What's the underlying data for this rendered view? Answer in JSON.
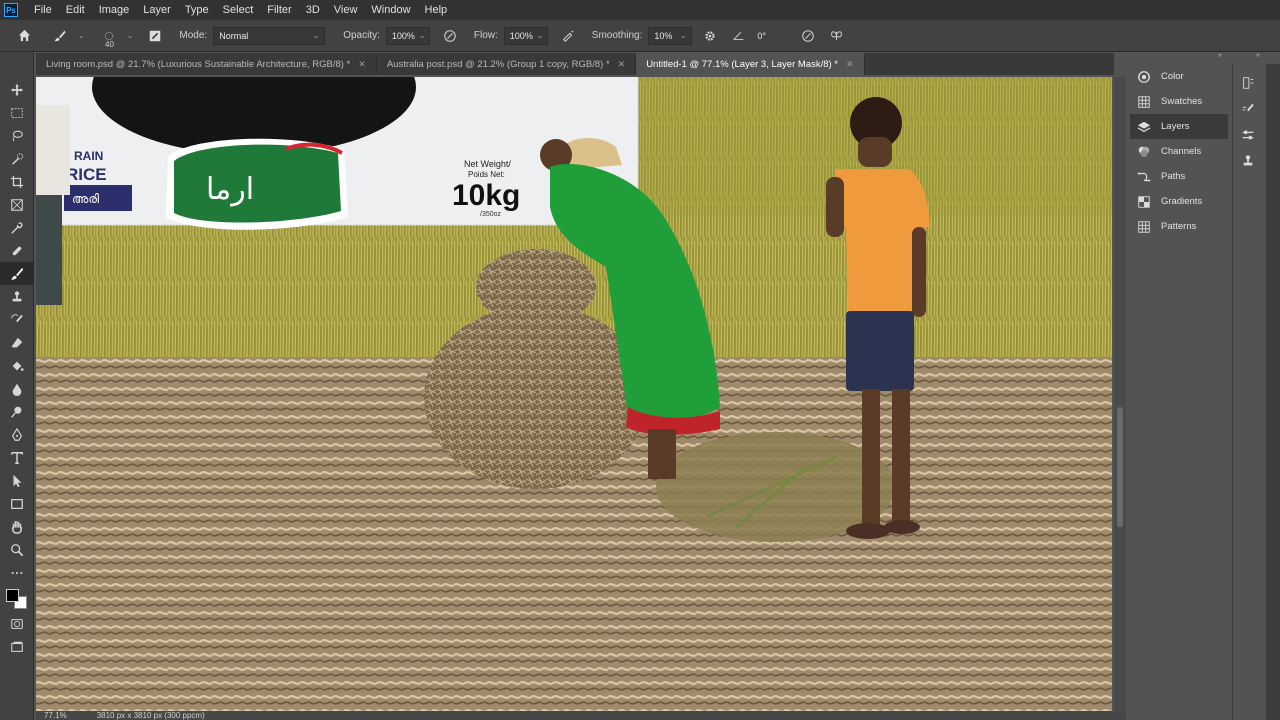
{
  "app": {
    "logo": "Ps"
  },
  "menu": [
    "File",
    "Edit",
    "Image",
    "Layer",
    "Type",
    "Select",
    "Filter",
    "3D",
    "View",
    "Window",
    "Help"
  ],
  "options": {
    "brush_size": "40",
    "mode_label": "Mode:",
    "mode_value": "Normal",
    "opacity_label": "Opacity:",
    "opacity_value": "100%",
    "flow_label": "Flow:",
    "flow_value": "100%",
    "smoothing_label": "Smoothing:",
    "smoothing_value": "10%",
    "angle_value": "0°"
  },
  "tabs": [
    {
      "label": "Living room.psd @ 21.7% (Luxurious Sustainable Architecture, RGB/8) *",
      "active": false
    },
    {
      "label": "Australia post.psd @ 21.2% (Group 1 copy, RGB/8) *",
      "active": false
    },
    {
      "label": "Untitled-1 @ 77.1% (Layer 3, Layer Mask/8) *",
      "active": true
    }
  ],
  "canvas": {
    "package_brand": "ارما",
    "package_line1": "RAIN",
    "package_line2": "RICE",
    "package_tag": "അരി",
    "net_weight_label": "Net Weight/",
    "net_weight_label2": "Poids Net:",
    "net_weight_value": "10kg",
    "net_weight_sub": "/350oz"
  },
  "panels": [
    {
      "label": "Color",
      "icon": "color-wheel-icon"
    },
    {
      "label": "Swatches",
      "icon": "swatches-grid-icon"
    },
    {
      "label": "Layers",
      "icon": "layers-icon",
      "active": true
    },
    {
      "label": "Channels",
      "icon": "channels-icon"
    },
    {
      "label": "Paths",
      "icon": "paths-icon"
    },
    {
      "label": "Gradients",
      "icon": "gradients-icon"
    },
    {
      "label": "Patterns",
      "icon": "patterns-icon"
    }
  ],
  "status": {
    "zoom": "77.1%",
    "doc_size": "3810 px x 3810 px (300 ppcm)"
  },
  "colors": {
    "accent": "#31a8ff",
    "menubar": "#323232",
    "panel": "#535353"
  }
}
